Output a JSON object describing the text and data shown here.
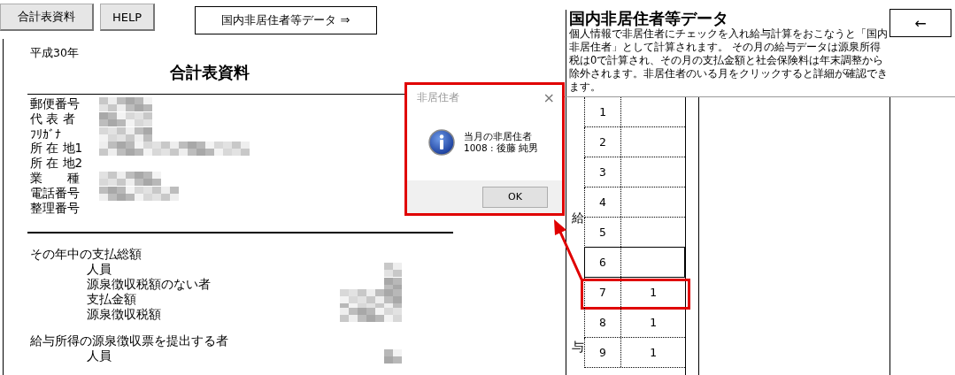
{
  "toolbar": {
    "buttons": [
      {
        "label": "合計表資料"
      },
      {
        "label": "HELP"
      }
    ],
    "link_button": {
      "label": "国内非居住者等データ ⇒"
    }
  },
  "summary": {
    "year": "平成30年",
    "title": "合計表資料",
    "fields": [
      {
        "label": "郵便番号",
        "redacted": true
      },
      {
        "label": "代 表 者",
        "redacted": true
      },
      {
        "label": "ﾌﾘｶﾞﾅ",
        "redacted": true
      },
      {
        "label": "所 在 地1",
        "redacted": true
      },
      {
        "label": "所 在 地2",
        "redacted": false
      },
      {
        "label": "業　　種",
        "redacted": true
      },
      {
        "label": "電話番号",
        "redacted": true
      },
      {
        "label": "整理番号",
        "redacted": false
      }
    ],
    "sections": [
      {
        "heading": "その年中の支払総額",
        "items": [
          {
            "label": "人員",
            "redacted": true
          },
          {
            "label": "源泉徴収税額のない者",
            "redacted": true
          },
          {
            "label": "支払金額",
            "redacted": true
          },
          {
            "label": "源泉徴収税額",
            "redacted": true
          }
        ]
      },
      {
        "heading": "給与所得の源泉徴収票を提出する者",
        "items": [
          {
            "label": "人員",
            "redacted": true
          }
        ]
      }
    ]
  },
  "nonresident": {
    "title": "国内非居住者等データ",
    "description": "個人情報で非居住者にチェックを入れ給与計算をおこなうと「国内非居住者」として計算されます。 その月の給与データは源泉所得税は0で計算され、その月の支払金額と社会保険料は年末調整から除外されます。非居住者のいる月をクリックすると詳細が確認できます。",
    "back_button": "←",
    "side_label": [
      "給",
      "与"
    ],
    "months": [
      {
        "month": "1",
        "selected": false,
        "highlighted": false
      },
      {
        "month": "2",
        "selected": false,
        "highlighted": false
      },
      {
        "month": "3",
        "selected": false,
        "highlighted": false
      },
      {
        "month": "4",
        "selected": false,
        "highlighted": false
      },
      {
        "month": "5",
        "selected": false,
        "highlighted": false
      },
      {
        "month": "6",
        "selected": true,
        "highlighted": false
      },
      {
        "month": "7",
        "count": "1",
        "selected": false,
        "highlighted": true
      },
      {
        "month": "8",
        "count": "1",
        "selected": false,
        "highlighted": false
      },
      {
        "month": "9",
        "count": "1",
        "selected": false,
        "highlighted": false
      }
    ]
  },
  "dialog": {
    "title": "非居住者",
    "close": "×",
    "lines": [
      "当月の非居住者",
      "1008 : 後藤 純男"
    ],
    "ok": "OK"
  }
}
